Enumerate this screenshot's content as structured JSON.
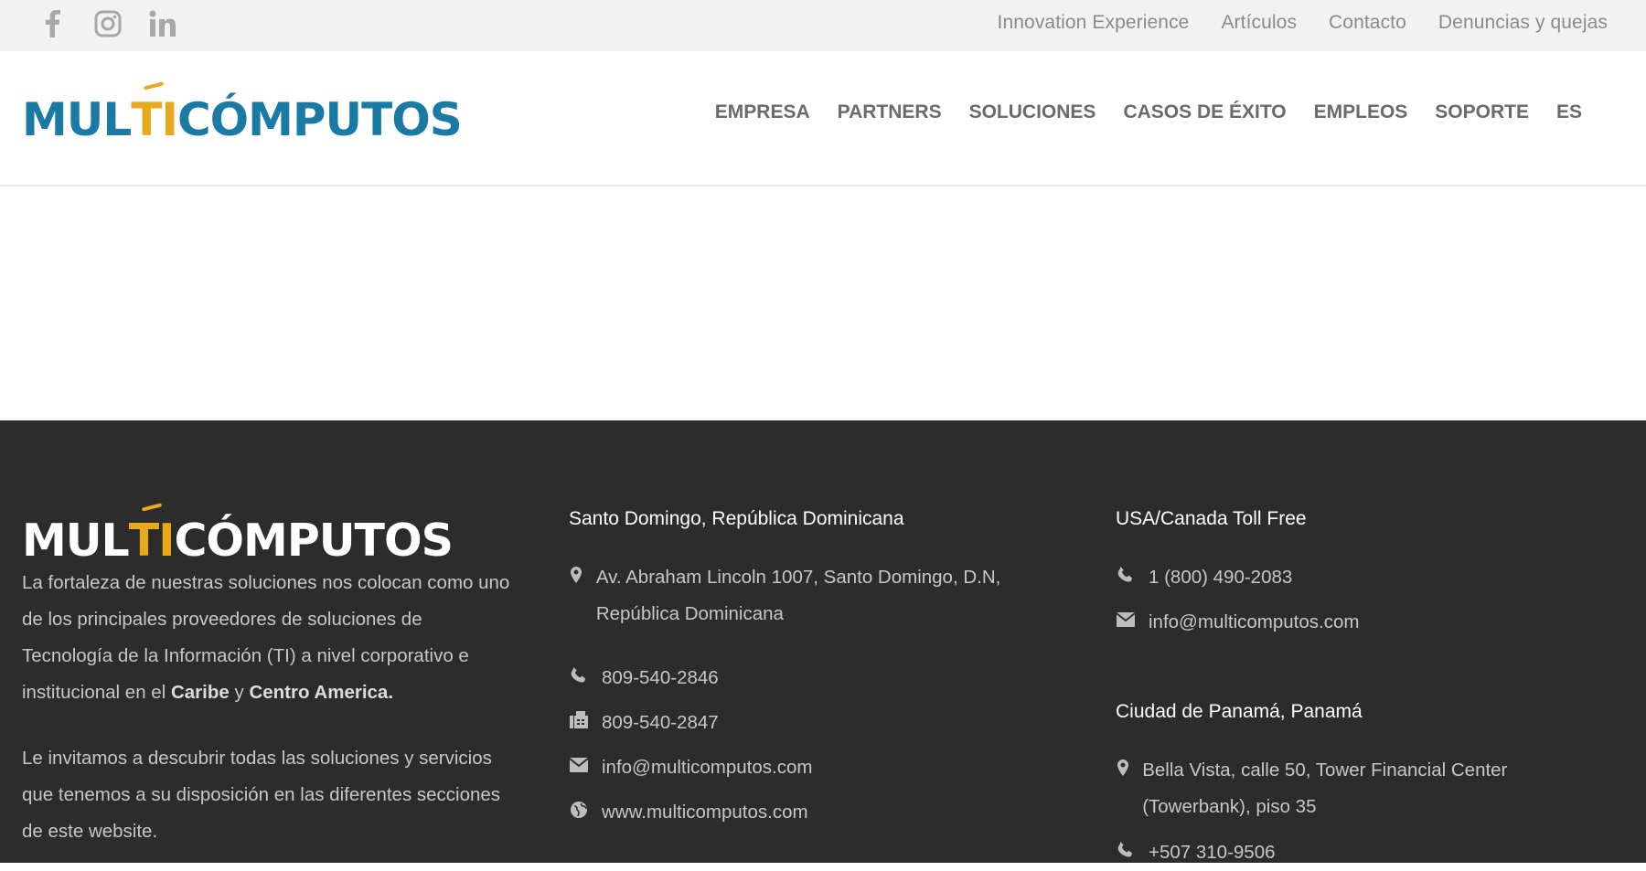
{
  "topbar": {
    "social": [
      "facebook-icon",
      "instagram-icon",
      "linkedin-icon"
    ],
    "links": [
      "Innovation Experience",
      "Artículos",
      "Contacto",
      "Denuncias y quejas"
    ]
  },
  "header": {
    "logo": "MULTICÓMPUTOS",
    "nav": [
      "EMPRESA",
      "PARTNERS",
      "SOLUCIONES",
      "CASOS DE ÉXITO",
      "EMPLEOS",
      "SOPORTE",
      "ES"
    ]
  },
  "footer": {
    "logo": "MULTICÓMPUTOS",
    "about": {
      "p1_a": "La fortaleza de nuestras soluciones nos colocan como uno de los principales proveedores de soluciones de Tecnología de la Información (TI) a nivel corporativo e institucional en el ",
      "p1_b": "Caribe",
      "p1_c": " y ",
      "p1_d": "Centro America.",
      "p2": "Le invitamos a descubrir todas las soluciones y servicios que tenemos a su disposición en las diferentes secciones de este website."
    },
    "santo_domingo": {
      "title": "Santo Domingo, República Dominicana",
      "address": "Av. Abraham Lincoln 1007, Santo Domingo, D.N, República Dominicana",
      "phone": "809-540-2846",
      "fax": "809-540-2847",
      "email": "info@multicomputos.com",
      "web": "www.multicomputos.com"
    },
    "usa": {
      "title": "USA/Canada Toll Free",
      "phone": "1 (800) 490-2083",
      "email": "info@multicomputos.com"
    },
    "panama": {
      "title": "Ciudad de Panamá, Panamá",
      "address": "Bella Vista, calle 50, Tower Financial Center (Towerbank), piso 35",
      "phone": "+507 310-9506"
    }
  },
  "colors": {
    "brand_blue": "#1a7aa6",
    "brand_orange": "#e9a91c",
    "footer_bg": "#2c2c2c"
  }
}
